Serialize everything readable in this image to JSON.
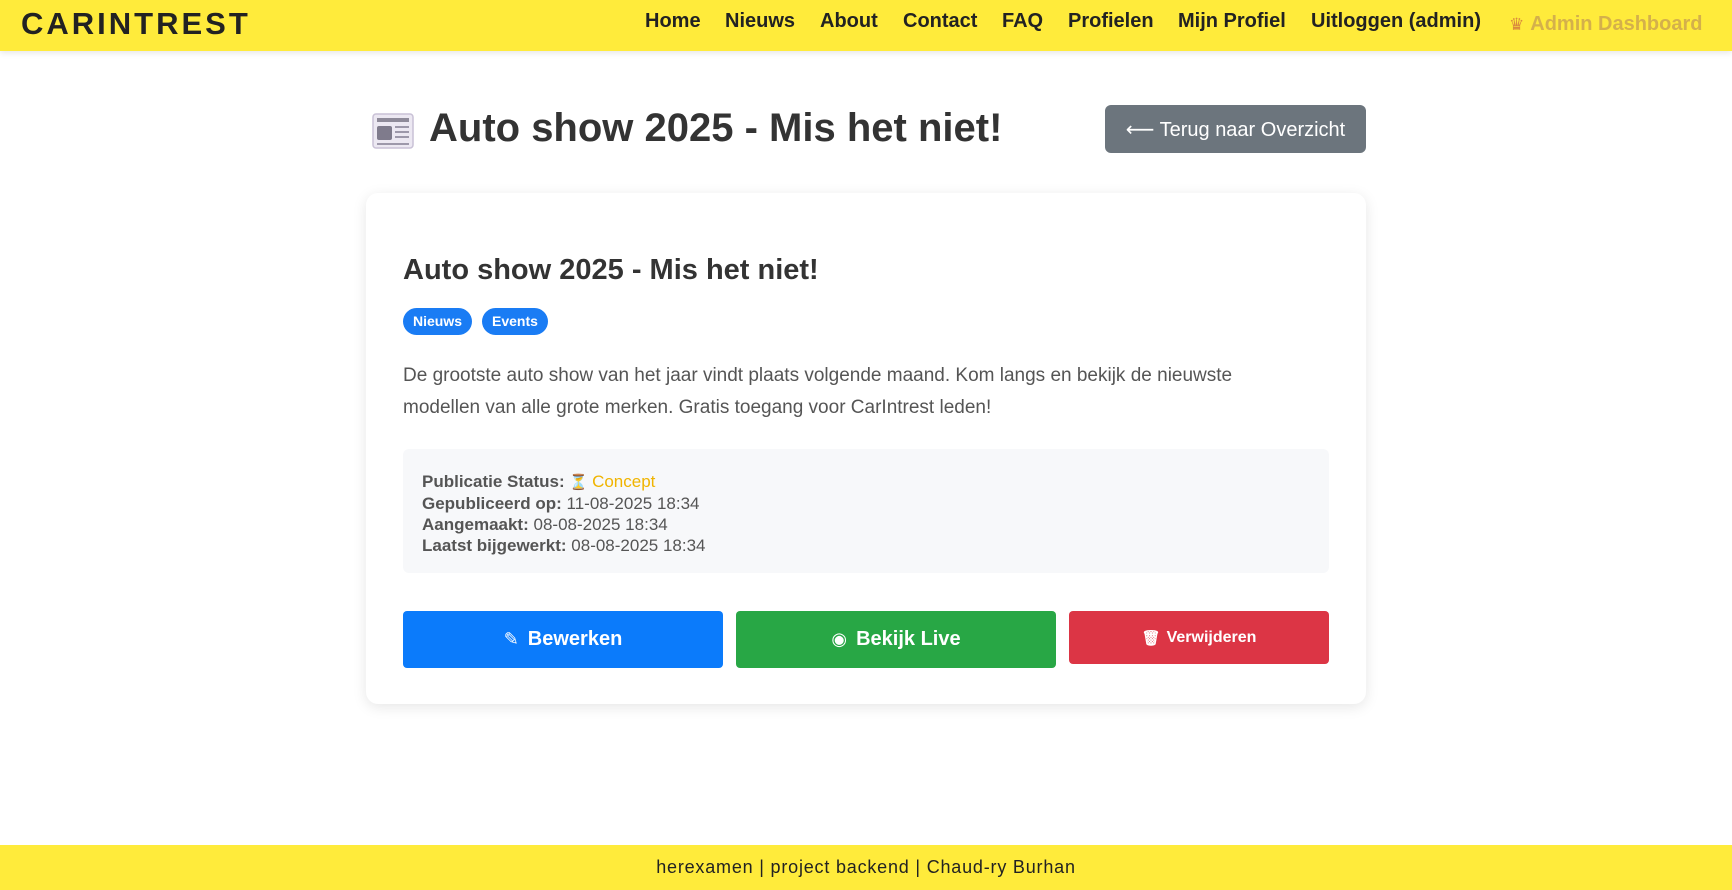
{
  "header": {
    "brand": "CARINTREST",
    "nav": {
      "home": "Home",
      "nieuws": "Nieuws",
      "about": "About",
      "contact": "Contact",
      "faq": "FAQ",
      "profielen": "Profielen",
      "mijn_profiel": "Mijn Profiel",
      "uitloggen": "Uitloggen (admin)",
      "admin_dashboard": "Admin Dashboard",
      "admin_icon": "crown-icon"
    }
  },
  "page": {
    "title": "Auto show 2025 - Mis het niet!",
    "title_icon": "newspaper-icon",
    "back_button": "⟵ Terug naar Overzicht"
  },
  "article": {
    "title": "Auto show 2025 - Mis het niet!",
    "badges": [
      "Nieuws",
      "Events"
    ],
    "body": "De grootste auto show van het jaar vindt plaats volgende maand. Kom langs en bekijk de nieuwste modellen van alle grote merken. Gratis toegang voor CarIntrest leden!",
    "meta": {
      "status_label": "Publicatie Status:",
      "status_icon": "hourglass-icon",
      "status_value": "Concept",
      "published_label": "Gepubliceerd op:",
      "published_value": "11-08-2025 18:34",
      "created_label": "Aangemaakt:",
      "created_value": "08-08-2025 18:34",
      "updated_label": "Laatst bijgewerkt:",
      "updated_value": "08-08-2025 18:34"
    },
    "actions": {
      "edit": "Bewerken",
      "live": "Bekijk Live",
      "delete": "Verwijderen"
    }
  },
  "footer": {
    "text": "herexamen | project backend | Chaud-ry Burhan"
  },
  "colors": {
    "header_bg": "#ffeb3b",
    "primary": "#0b7bfb",
    "success": "#28a745",
    "danger": "#dc3545",
    "secondary": "#6c757d",
    "status_concept": "#f0b400"
  }
}
